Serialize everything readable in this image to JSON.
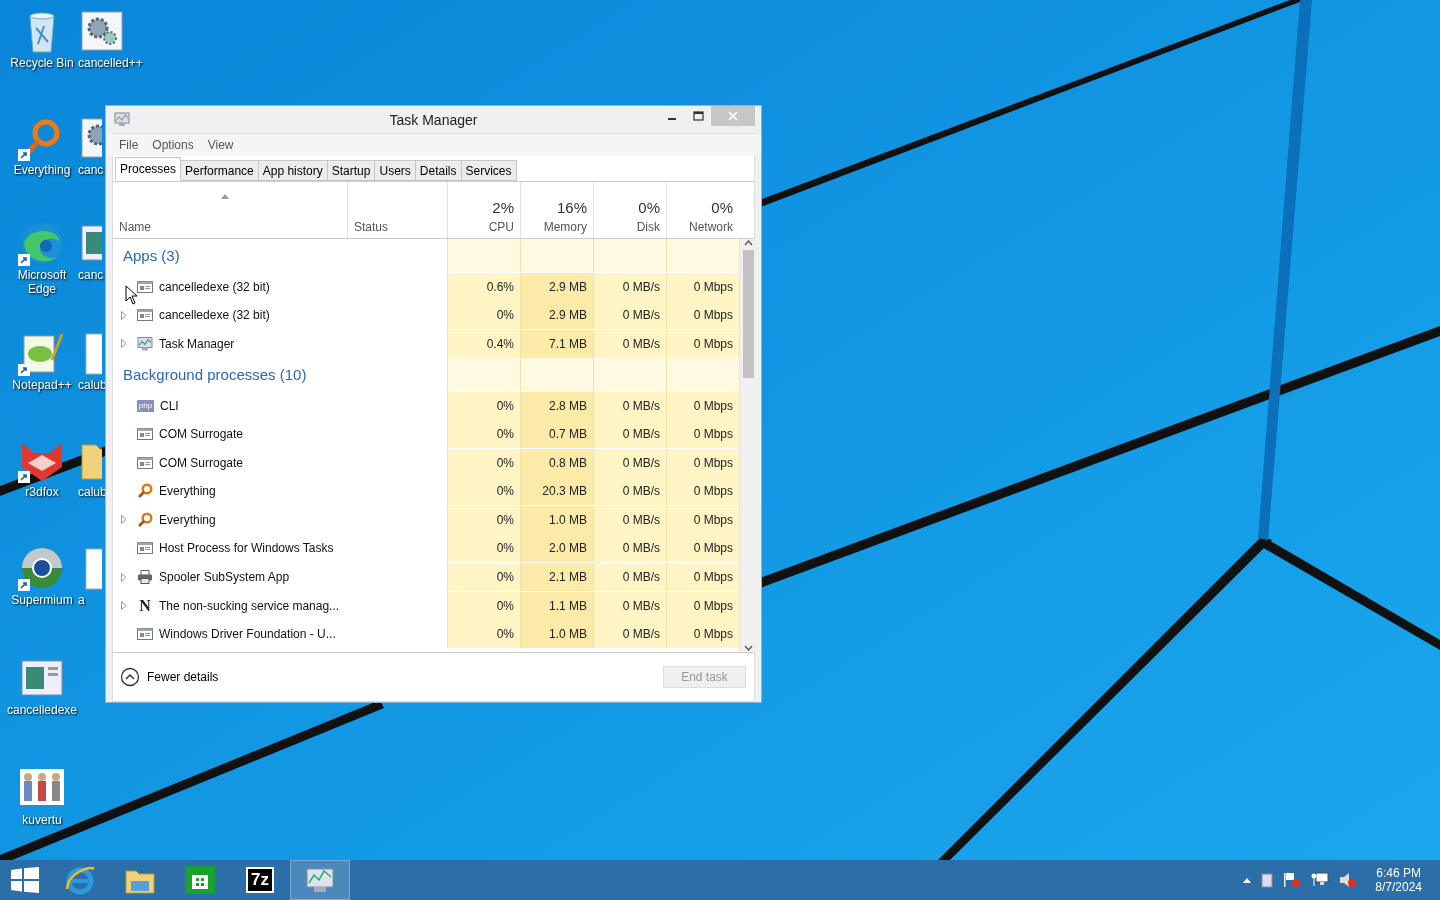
{
  "desktop_icons": [
    {
      "label": "Recycle Bin",
      "kind": "bin",
      "shortcut": false
    },
    {
      "label": "cancelled++",
      "kind": "gears",
      "shortcut": false
    },
    {
      "label": "Everything",
      "kind": "key",
      "shortcut": true
    },
    {
      "label": "canc",
      "kind": "gears",
      "shortcut": false
    },
    {
      "label": "Microsoft Edge",
      "kind": "edge",
      "shortcut": true
    },
    {
      "label": "canc",
      "kind": "window",
      "shortcut": false
    },
    {
      "label": "Notepad++",
      "kind": "notepad",
      "shortcut": true
    },
    {
      "label": "calub",
      "kind": "doc",
      "shortcut": false
    },
    {
      "label": "r3dfox",
      "kind": "fox",
      "shortcut": true
    },
    {
      "label": "calub",
      "kind": "folder",
      "shortcut": false
    },
    {
      "label": "Supermium",
      "kind": "globe",
      "shortcut": true
    },
    {
      "label": "a",
      "kind": "doc",
      "shortcut": false
    },
    {
      "label": "cancelledexe",
      "kind": "window",
      "shortcut": false
    },
    {
      "label": "kuvertu",
      "kind": "figures",
      "shortcut": false
    }
  ],
  "window": {
    "title": "Task Manager",
    "menu": [
      "File",
      "Options",
      "View"
    ],
    "tabs": [
      {
        "label": "Processes",
        "selected": true
      },
      {
        "label": "Performance",
        "selected": false
      },
      {
        "label": "App history",
        "selected": false
      },
      {
        "label": "Startup",
        "selected": false
      },
      {
        "label": "Users",
        "selected": false
      },
      {
        "label": "Details",
        "selected": false
      },
      {
        "label": "Services",
        "selected": false
      }
    ],
    "columns": [
      {
        "label": "Name"
      },
      {
        "label": "Status"
      },
      {
        "usage": "2%",
        "label": "CPU"
      },
      {
        "usage": "16%",
        "label": "Memory"
      },
      {
        "usage": "0%",
        "label": "Disk"
      },
      {
        "usage": "0%",
        "label": "Network"
      }
    ],
    "groups": [
      {
        "title": "Apps (3)",
        "rows": [
          {
            "name": "cancelledexe (32 bit)",
            "kind": "window",
            "expandable": false,
            "cpu": "0.6%",
            "memory": "2.9 MB",
            "disk": "0 MB/s",
            "network": "0 Mbps"
          },
          {
            "name": "cancelledexe (32 bit)",
            "kind": "window",
            "expandable": true,
            "cpu": "0%",
            "memory": "2.9 MB",
            "disk": "0 MB/s",
            "network": "0 Mbps"
          },
          {
            "name": "Task Manager",
            "kind": "taskmgr",
            "expandable": true,
            "cpu": "0.4%",
            "memory": "7.1 MB",
            "disk": "0 MB/s",
            "network": "0 Mbps"
          }
        ]
      },
      {
        "title": "Background processes (10)",
        "rows": [
          {
            "name": "CLI",
            "kind": "letters",
            "icon_text": "php",
            "expandable": false,
            "cpu": "0%",
            "memory": "2.8 MB",
            "disk": "0 MB/s",
            "network": "0 Mbps"
          },
          {
            "name": "COM Surrogate",
            "kind": "window",
            "expandable": false,
            "cpu": "0%",
            "memory": "0.7 MB",
            "disk": "0 MB/s",
            "network": "0 Mbps"
          },
          {
            "name": "COM Surrogate",
            "kind": "window",
            "expandable": false,
            "cpu": "0%",
            "memory": "0.8 MB",
            "disk": "0 MB/s",
            "network": "0 Mbps"
          },
          {
            "name": "Everything",
            "kind": "key",
            "expandable": false,
            "cpu": "0%",
            "memory": "20.3 MB",
            "disk": "0 MB/s",
            "network": "0 Mbps"
          },
          {
            "name": "Everything",
            "kind": "key",
            "expandable": true,
            "cpu": "0%",
            "memory": "1.0 MB",
            "disk": "0 MB/s",
            "network": "0 Mbps"
          },
          {
            "name": "Host Process for Windows Tasks",
            "kind": "window",
            "expandable": false,
            "cpu": "0%",
            "memory": "2.0 MB",
            "disk": "0 MB/s",
            "network": "0 Mbps"
          },
          {
            "name": "Spooler SubSystem App",
            "kind": "printer",
            "expandable": true,
            "cpu": "0%",
            "memory": "2.1 MB",
            "disk": "0 MB/s",
            "network": "0 Mbps"
          },
          {
            "name": "The non-sucking service manag...",
            "kind": "serif",
            "icon_text": "N",
            "expandable": true,
            "cpu": "0%",
            "memory": "1.1 MB",
            "disk": "0 MB/s",
            "network": "0 Mbps"
          },
          {
            "name": "Windows Driver Foundation - U...",
            "kind": "window",
            "expandable": false,
            "cpu": "0%",
            "memory": "1.0 MB",
            "disk": "0 MB/s",
            "network": "0 Mbps"
          }
        ]
      }
    ],
    "fewer_details": "Fewer details",
    "end_task": {
      "label": "End task",
      "disabled": true
    }
  },
  "taskbar": {
    "apps": [
      {
        "kind": "ie",
        "selected": false
      },
      {
        "kind": "explorer",
        "selected": false
      },
      {
        "kind": "store",
        "selected": false
      },
      {
        "kind": "sevenzip",
        "text": "7z",
        "selected": false
      },
      {
        "kind": "taskmgr",
        "selected": true
      }
    ],
    "clock": {
      "time": "6:46 PM",
      "date": "8/7/2024"
    }
  }
}
